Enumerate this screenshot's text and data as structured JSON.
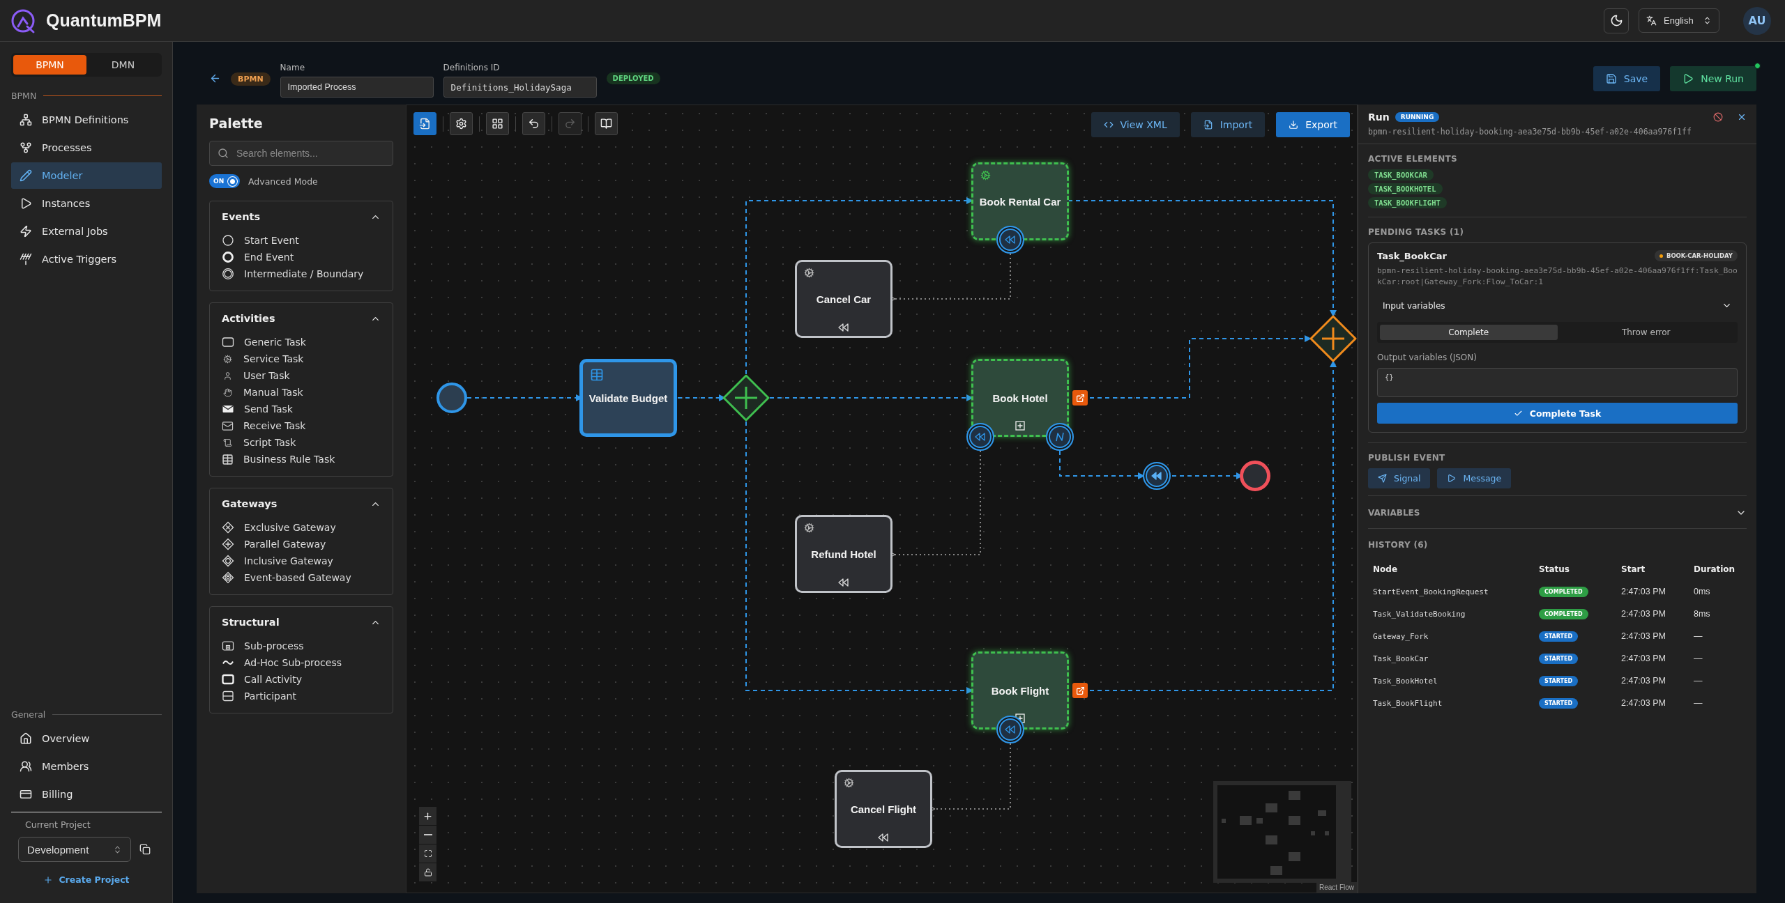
{
  "app": {
    "name": "QuantumBPM"
  },
  "header": {
    "language": "English",
    "avatar": "AU"
  },
  "sidebar": {
    "mode_tabs": [
      {
        "label": "BPMN",
        "selected": true
      },
      {
        "label": "DMN",
        "selected": false
      }
    ],
    "sections": [
      {
        "title": "BPMN",
        "items": [
          {
            "label": "BPMN Definitions",
            "kind": "definitions",
            "selected": false
          },
          {
            "label": "Processes",
            "kind": "processes",
            "selected": false
          },
          {
            "label": "Modeler",
            "kind": "modeler",
            "selected": true
          },
          {
            "label": "Instances",
            "kind": "instances",
            "selected": false
          },
          {
            "label": "External Jobs",
            "kind": "jobs",
            "selected": false
          },
          {
            "label": "Active Triggers",
            "kind": "triggers",
            "selected": false
          }
        ]
      },
      {
        "title": "General",
        "items": [
          {
            "label": "Overview",
            "kind": "overview",
            "selected": false
          },
          {
            "label": "Members",
            "kind": "members",
            "selected": false
          },
          {
            "label": "Billing",
            "kind": "billing",
            "selected": false
          }
        ]
      }
    ],
    "project_label": "Current Project",
    "project": "Development",
    "create_project": "Create Project"
  },
  "editor": {
    "type_badge": "BPMN",
    "name_label": "Name",
    "name": "Imported Process",
    "definitions_label": "Definitions ID",
    "definitions_id": "Definitions_HolidaySaga",
    "status": "DEPLOYED",
    "save": "Save",
    "new_run": "New Run"
  },
  "palette": {
    "title": "Palette",
    "search_placeholder": "Search elements...",
    "advanced_mode": {
      "label": "Advanced Mode",
      "switch_text": "ON",
      "on": true
    },
    "groups": [
      {
        "title": "Events",
        "expanded": true,
        "items": [
          {
            "label": "Start Event",
            "kind": "start-event"
          },
          {
            "label": "End Event",
            "kind": "end-event"
          },
          {
            "label": "Intermediate / Boundary",
            "kind": "intermediate-event"
          }
        ]
      },
      {
        "title": "Activities",
        "expanded": true,
        "items": [
          {
            "label": "Generic Task",
            "kind": "generic-task"
          },
          {
            "label": "Service Task",
            "kind": "service-task"
          },
          {
            "label": "User Task",
            "kind": "user-task"
          },
          {
            "label": "Manual Task",
            "kind": "manual-task"
          },
          {
            "label": "Send Task",
            "kind": "send-task"
          },
          {
            "label": "Receive Task",
            "kind": "receive-task"
          },
          {
            "label": "Script Task",
            "kind": "script-task"
          },
          {
            "label": "Business Rule Task",
            "kind": "business-rule-task"
          }
        ]
      },
      {
        "title": "Gateways",
        "expanded": true,
        "items": [
          {
            "label": "Exclusive Gateway",
            "kind": "exclusive-gateway"
          },
          {
            "label": "Parallel Gateway",
            "kind": "parallel-gateway"
          },
          {
            "label": "Inclusive Gateway",
            "kind": "inclusive-gateway"
          },
          {
            "label": "Event-based Gateway",
            "kind": "event-based-gateway"
          }
        ]
      },
      {
        "title": "Structural",
        "expanded": true,
        "items": [
          {
            "label": "Sub-process",
            "kind": "sub-process"
          },
          {
            "label": "Ad-Hoc Sub-process",
            "kind": "ad-hoc-sub-process"
          },
          {
            "label": "Call Activity",
            "kind": "call-activity"
          },
          {
            "label": "Participant",
            "kind": "participant"
          }
        ]
      }
    ]
  },
  "canvas": {
    "tools": [
      {
        "kind": "import",
        "selected": true,
        "disabled": false
      },
      {
        "kind": "settings",
        "selected": false,
        "disabled": false
      },
      {
        "kind": "layout",
        "selected": false,
        "disabled": false
      },
      {
        "kind": "undo",
        "selected": false,
        "disabled": false
      },
      {
        "kind": "redo",
        "selected": false,
        "disabled": true
      },
      {
        "kind": "docs",
        "selected": false,
        "disabled": false
      }
    ],
    "actions": [
      {
        "label": "View XML",
        "kind": "view-xml"
      },
      {
        "label": "Import",
        "kind": "import"
      },
      {
        "label": "Export",
        "kind": "export"
      }
    ],
    "nodes": [
      {
        "kind": "start-event"
      },
      {
        "kind": "business-rule-task",
        "label": "Validate Budget",
        "active": false,
        "completed": true,
        "external": false
      },
      {
        "kind": "parallel-gateway",
        "completed": true
      },
      {
        "kind": "service-task",
        "label": "Book Rental Car",
        "active": true,
        "completed": false,
        "external": false
      },
      {
        "kind": "compensation-boundary"
      },
      {
        "kind": "compensation-task",
        "label": "Cancel Car",
        "active": false,
        "completed": false,
        "external": false
      },
      {
        "kind": "subprocess",
        "label": "Book Hotel",
        "active": true,
        "completed": false,
        "external": true
      },
      {
        "kind": "compensation-boundary"
      },
      {
        "kind": "escalation-boundary"
      },
      {
        "kind": "compensation-throw"
      },
      {
        "kind": "end-event"
      },
      {
        "kind": "compensation-task",
        "label": "Refund Hotel",
        "active": false,
        "completed": false,
        "external": false
      },
      {
        "kind": "parallel-gateway",
        "completed": false
      },
      {
        "kind": "subprocess",
        "label": "Book Flight",
        "active": true,
        "completed": false,
        "external": true
      },
      {
        "kind": "compensation-boundary"
      },
      {
        "kind": "compensation-task",
        "label": "Cancel Flight",
        "active": false,
        "completed": false,
        "external": false
      }
    ],
    "attribution": "React Flow"
  },
  "run": {
    "title": "Run",
    "status": "RUNNING",
    "id": "bpmn-resilient-holiday-booking-aea3e75d-bb9b-45ef-a02e-406aa976f1ff",
    "active_title": "ACTIVE ELEMENTS",
    "active_elements": [
      "TASK_BOOKCAR",
      "TASK_BOOKHOTEL",
      "TASK_BOOKFLIGHT"
    ],
    "pending_title": "PENDING TASKS (1)",
    "pending": [
      {
        "name": "Task_BookCar",
        "topic": "BOOK-CAR-HOLIDAY",
        "id": "bpmn-resilient-holiday-booking-aea3e75d-bb9b-45ef-a02e-406aa976f1ff:Task_BookCar:root|Gateway_Fork:Flow_ToCar:1",
        "input_label": "Input variables",
        "input_expanded": false,
        "modes": [
          {
            "label": "Complete",
            "selected": true
          },
          {
            "label": "Throw error",
            "selected": false
          }
        ],
        "output_label": "Output variables (JSON)",
        "output": "{}",
        "submit": "Complete Task"
      }
    ],
    "publish_title": "PUBLISH EVENT",
    "publish": [
      {
        "label": "Signal",
        "kind": "signal"
      },
      {
        "label": "Message",
        "kind": "message"
      }
    ],
    "variables_title": "VARIABLES",
    "variables_expanded": false,
    "history_title": "HISTORY (6)",
    "history": {
      "columns": [
        "Node",
        "Status",
        "Start",
        "Duration"
      ],
      "rows": [
        {
          "node": "StartEvent_BookingRequest",
          "status": "COMPLETED",
          "completed": true,
          "start": "2:47:03 PM",
          "duration": "0ms"
        },
        {
          "node": "Task_ValidateBooking",
          "status": "COMPLETED",
          "completed": true,
          "start": "2:47:03 PM",
          "duration": "8ms"
        },
        {
          "node": "Gateway_Fork",
          "status": "STARTED",
          "completed": false,
          "start": "2:47:03 PM",
          "duration": "—"
        },
        {
          "node": "Task_BookCar",
          "status": "STARTED",
          "completed": false,
          "start": "2:47:03 PM",
          "duration": "—"
        },
        {
          "node": "Task_BookHotel",
          "status": "STARTED",
          "completed": false,
          "start": "2:47:03 PM",
          "duration": "—"
        },
        {
          "node": "Task_BookFlight",
          "status": "STARTED",
          "completed": false,
          "start": "2:47:03 PM",
          "duration": "—"
        }
      ]
    }
  }
}
